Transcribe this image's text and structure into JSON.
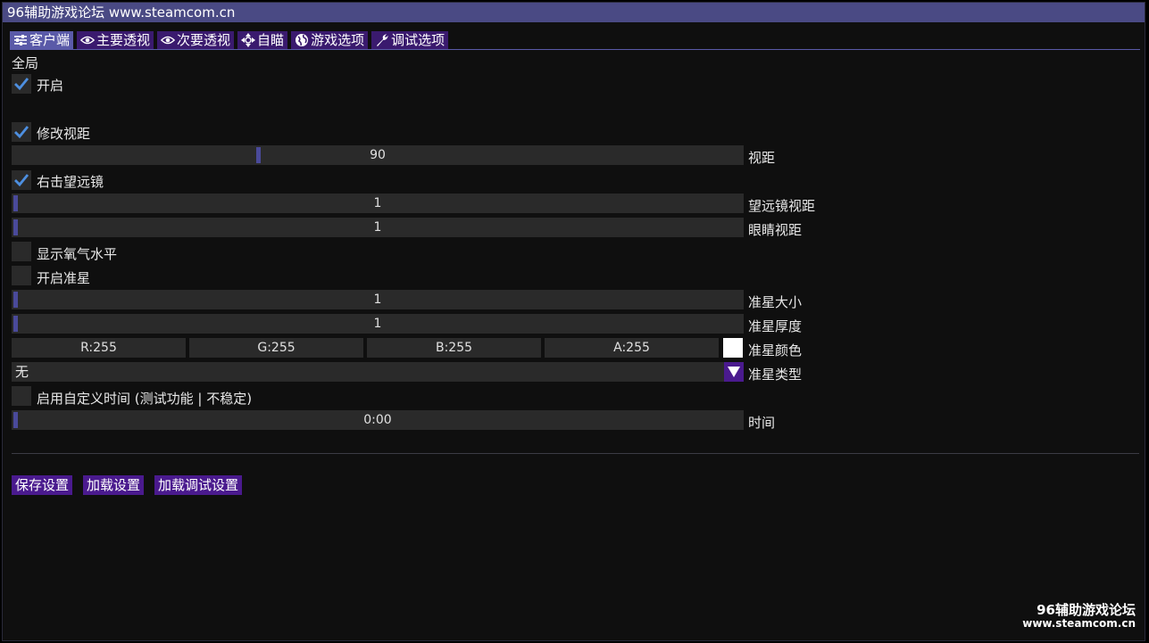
{
  "window": {
    "title": "96辅助游戏论坛 www.steamcom.cn"
  },
  "tabs": [
    {
      "label": "客户端",
      "icon": "sliders-icon",
      "active": true
    },
    {
      "label": "主要透视",
      "icon": "eye-icon"
    },
    {
      "label": "次要透视",
      "icon": "eye-icon"
    },
    {
      "label": "自瞄",
      "icon": "crosshair-arrows-icon"
    },
    {
      "label": "游戏选项",
      "icon": "globe-icon"
    },
    {
      "label": "调试选项",
      "icon": "wrench-icon"
    }
  ],
  "section": {
    "title": "全局"
  },
  "checkboxes": {
    "enable": {
      "label": "开启",
      "checked": true
    },
    "modify_fov": {
      "label": "修改视距",
      "checked": true
    },
    "scope": {
      "label": "右击望远镜",
      "checked": true
    },
    "oxygen": {
      "label": "显示氧气水平",
      "checked": false
    },
    "crosshair": {
      "label": "开启准星",
      "checked": false
    },
    "custom_time": {
      "label": "启用自定义时间 (测试功能 | 不稳定)",
      "checked": false
    }
  },
  "sliders": {
    "fov": {
      "value": "90",
      "label": "视距",
      "fraction": 0.335
    },
    "scope_fov": {
      "value": "1",
      "label": "望远镜视距",
      "fraction": 0
    },
    "eye_fov": {
      "value": "1",
      "label": "眼睛视距",
      "fraction": 0
    },
    "crosshair_size": {
      "value": "1",
      "label": "准星大小",
      "fraction": 0
    },
    "crosshair_thickness": {
      "value": "1",
      "label": "准星厚度",
      "fraction": 0
    },
    "time": {
      "value": "0:00",
      "label": "时间",
      "fraction": 0
    }
  },
  "color": {
    "r": "R:255",
    "g": "G:255",
    "b": "B:255",
    "a": "A:255",
    "label": "准星颜色",
    "swatch": "#ffffff"
  },
  "crosshair_type": {
    "value": "无",
    "label": "准星类型"
  },
  "buttons": {
    "save": "保存设置",
    "load": "加载设置",
    "load_debug": "加载调试设置"
  },
  "watermark": {
    "line1": "96辅助游戏论坛",
    "line2": "www.steamcom.cn"
  },
  "colors": {
    "title_bar": "#4a4a84",
    "accent": "#4a1a8e",
    "check": "#4d8fe0"
  }
}
